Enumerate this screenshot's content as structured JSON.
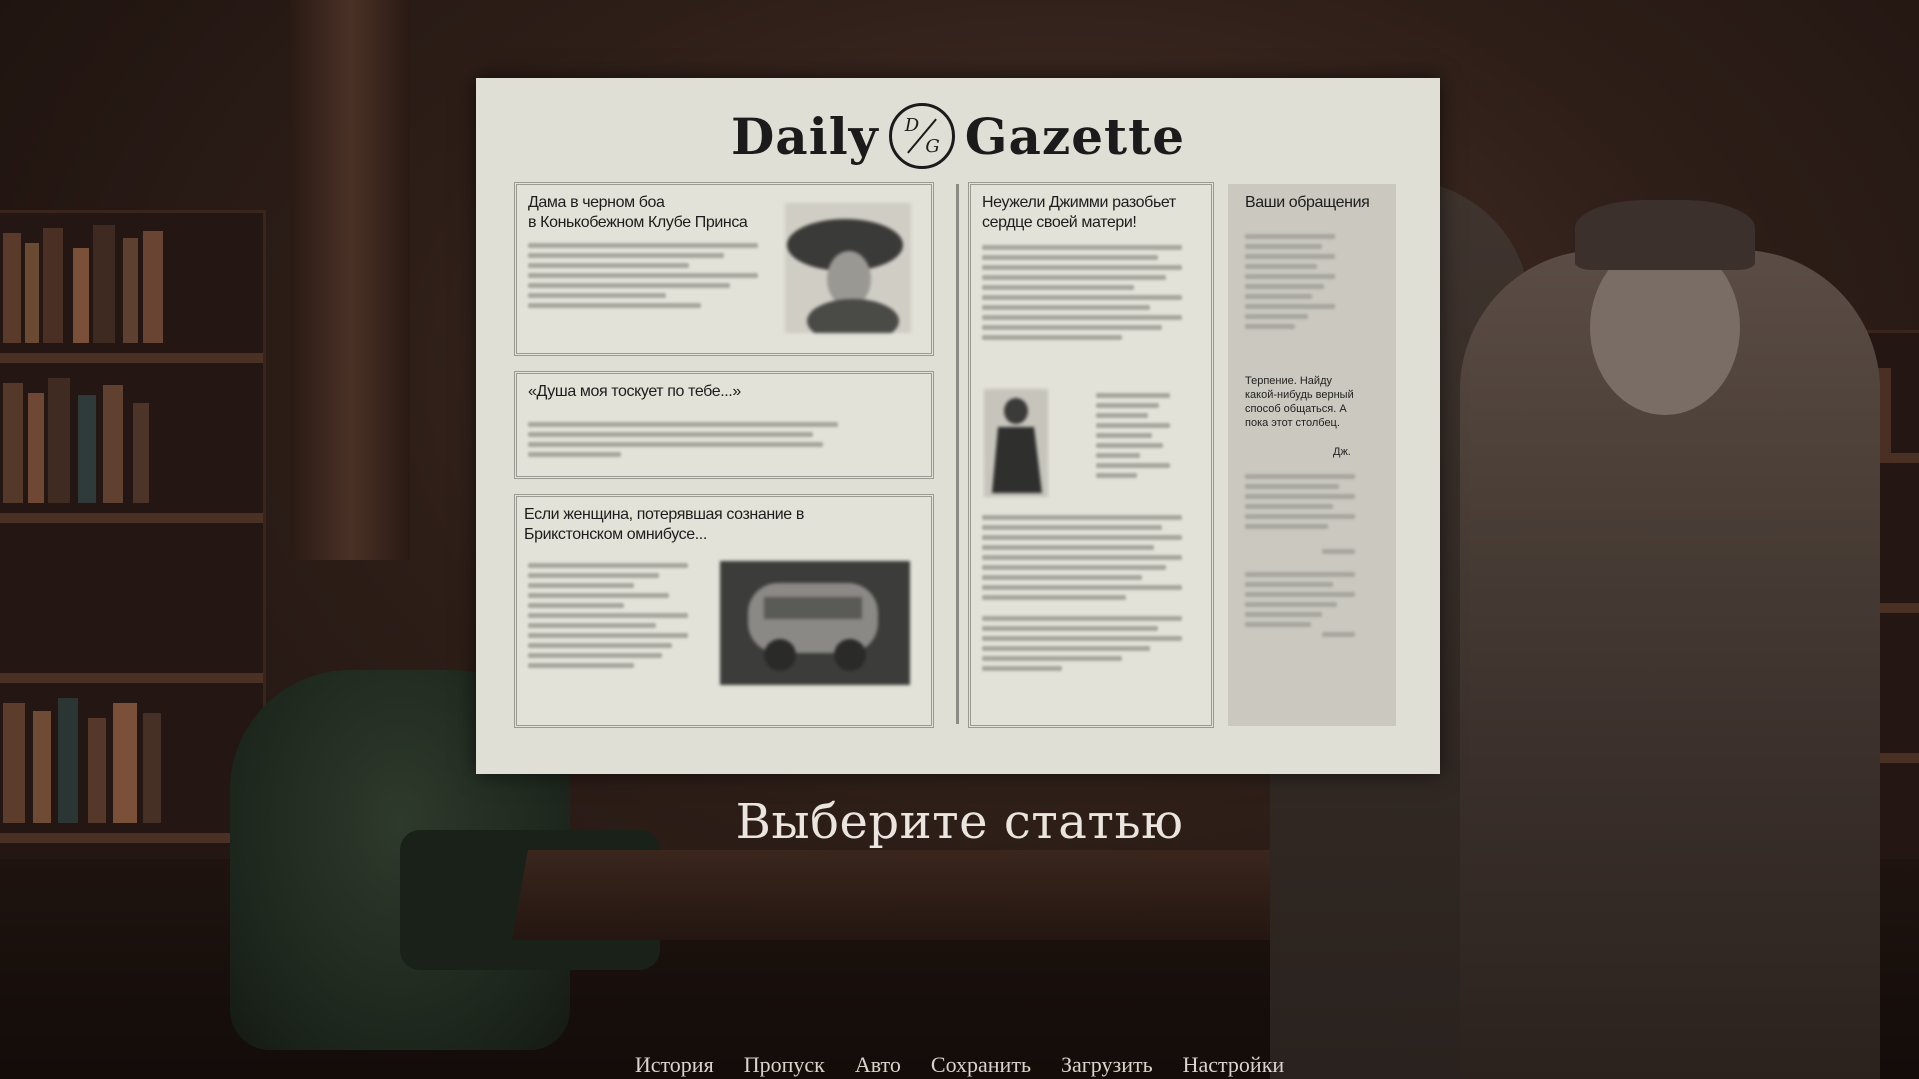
{
  "gazette": {
    "masthead_left": "Daily",
    "masthead_right": "Gazette",
    "emblem_top": "D",
    "emblem_bottom": "G"
  },
  "articles": {
    "boa_title_1": "Дама в черном боа",
    "boa_title_2": "в Конькобежном Клубе Принса",
    "soul_title": "«Душа моя тоскует по тебе...»",
    "omnibus_title_1": "Если женщина, потерявшая сознание в",
    "omnibus_title_2": "Брикстонском омнибусе...",
    "jimmy_title_1": "Неужели Джимми разобьет",
    "jimmy_title_2": "сердце своей матери!"
  },
  "letters": {
    "title": "Ваши обращения",
    "clear_text": "Терпение. Найду какой-нибудь верный способ общаться. А пока этот столбец.",
    "signature": "Дж."
  },
  "prompt": "Выберите статью",
  "menu": {
    "history": "История",
    "skip": "Пропуск",
    "auto": "Авто",
    "save": "Сохранить",
    "load": "Загрузить",
    "settings": "Настройки"
  }
}
